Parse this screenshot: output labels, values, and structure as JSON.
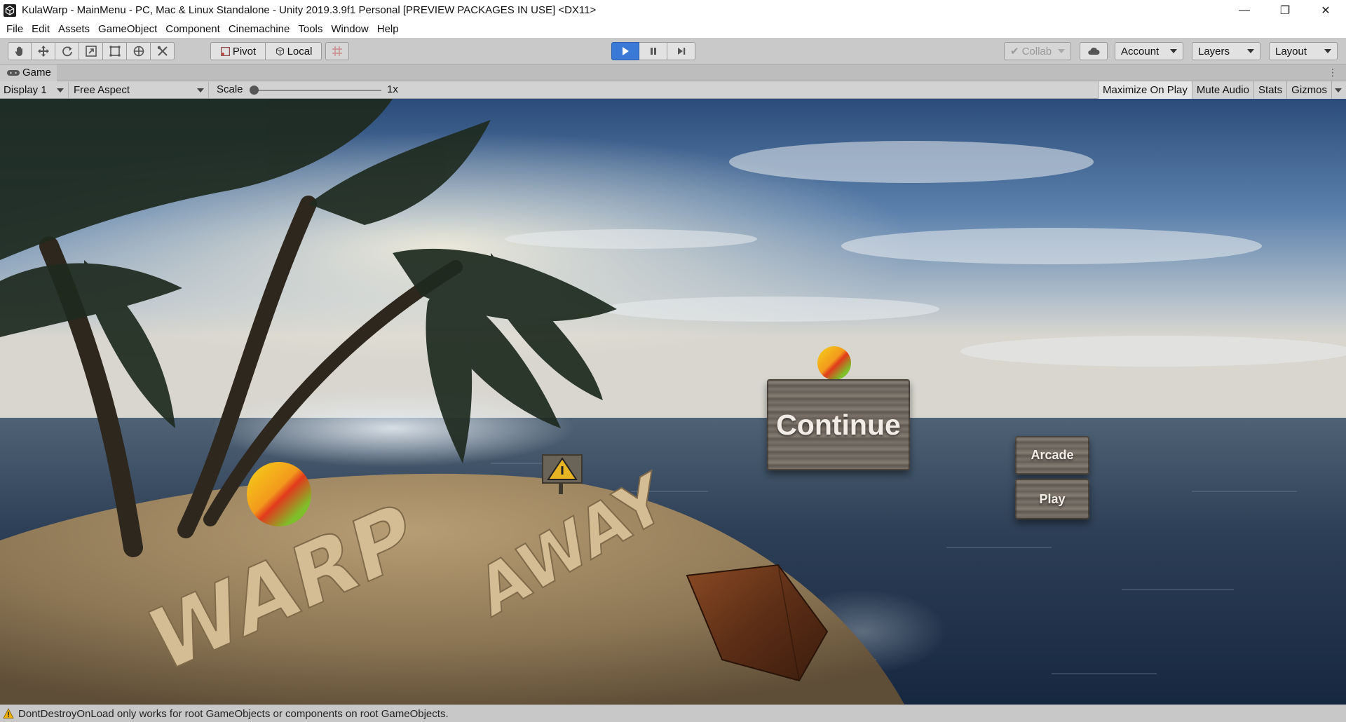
{
  "window": {
    "title": "KulaWarp - MainMenu - PC, Mac & Linux Standalone - Unity 2019.3.9f1 Personal [PREVIEW PACKAGES IN USE] <DX11>",
    "controls": {
      "minimize": "—",
      "restore": "❐",
      "close": "✕"
    }
  },
  "menu": {
    "items": [
      "File",
      "Edit",
      "Assets",
      "GameObject",
      "Component",
      "Cinemachine",
      "Tools",
      "Window",
      "Help"
    ]
  },
  "toolbar": {
    "transform_tools": [
      "hand-icon",
      "move-icon",
      "rotate-icon",
      "scale-icon",
      "rect-icon",
      "transform-icon",
      "custom-tool-icon"
    ],
    "pivot_label": "Pivot",
    "local_label": "Local",
    "playback": {
      "play": "play-icon",
      "pause": "pause-icon",
      "step": "step-icon",
      "play_active": true
    },
    "collab_label": "Collab",
    "account_label": "Account",
    "layers_label": "Layers",
    "layout_label": "Layout",
    "accent_color": "#3a79d6"
  },
  "game_panel": {
    "tab_label": "Game",
    "display_label": "Display 1",
    "aspect_label": "Free Aspect",
    "scale_label": "Scale",
    "scale_value": "1x",
    "maximize_on_play_label": "Maximize On Play",
    "mute_audio_label": "Mute Audio",
    "stats_label": "Stats",
    "gizmos_label": "Gizmos"
  },
  "scene": {
    "continue_label": "Continue",
    "arcade_label": "Arcade",
    "play_label": "Play",
    "sand_text_1": "WARP",
    "sand_text_2": "AWAY"
  },
  "status": {
    "message": "DontDestroyOnLoad only works for root GameObjects or components on root GameObjects."
  }
}
